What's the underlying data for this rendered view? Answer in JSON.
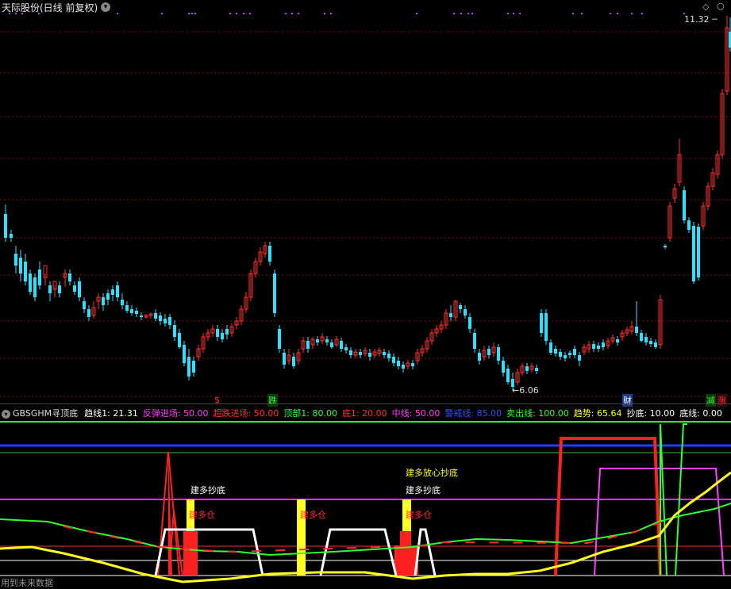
{
  "header": {
    "title": "天际股份(日线 前复权)",
    "dropdown_icon": "chevron-down-icon",
    "diamond_icon": "diamond-icon"
  },
  "main": {
    "price_high_label": "11.32",
    "price_low_label": "6.06",
    "markers": [
      {
        "text": "$",
        "color": "#ff3030"
      },
      {
        "text": "跌",
        "color": "#30ff30",
        "bg": "#0a3a0a"
      },
      {
        "text": "财",
        "color": "#ffffff",
        "bg": "#1a3a8a"
      },
      {
        "text": "减",
        "color": "#30ff30",
        "bg": "#0a3a0a"
      },
      {
        "text": "涨",
        "color": "#ff3030",
        "bg": "#3a0a0a"
      }
    ]
  },
  "indicator": {
    "name": "GBSGHM寻顶底",
    "values": [
      {
        "text": "趋线1: 21.31",
        "color": "#ffffff"
      },
      {
        "text": "反弹进场: 50.00",
        "color": "#ff40ff"
      },
      {
        "text": "超跌进场: 50.00",
        "color": "#ff3030"
      },
      {
        "text": "顶部1: 80.00",
        "color": "#30ff30"
      },
      {
        "text": "底1: 20.00",
        "color": "#ff3030"
      },
      {
        "text": "中线: 50.00",
        "color": "#ff40ff"
      },
      {
        "text": "警戒线: 85.00",
        "color": "#3050ff"
      },
      {
        "text": "卖出线: 100.00",
        "color": "#30ff30"
      },
      {
        "text": "趋势: 65.64",
        "color": "#ffff30"
      },
      {
        "text": "抄底: 10.00",
        "color": "#ffffff"
      },
      {
        "text": "底线: 0.00",
        "color": "#ffffff"
      }
    ],
    "annotations": {
      "build_bottom": "建多抄底",
      "build_position": "建多仓",
      "build_relax_bottom": "建多放心抄底"
    },
    "footer": "用到未来数据"
  },
  "colors": {
    "up": "#ff3030",
    "down": "#30e0ff",
    "grid": "#7a1010"
  }
}
